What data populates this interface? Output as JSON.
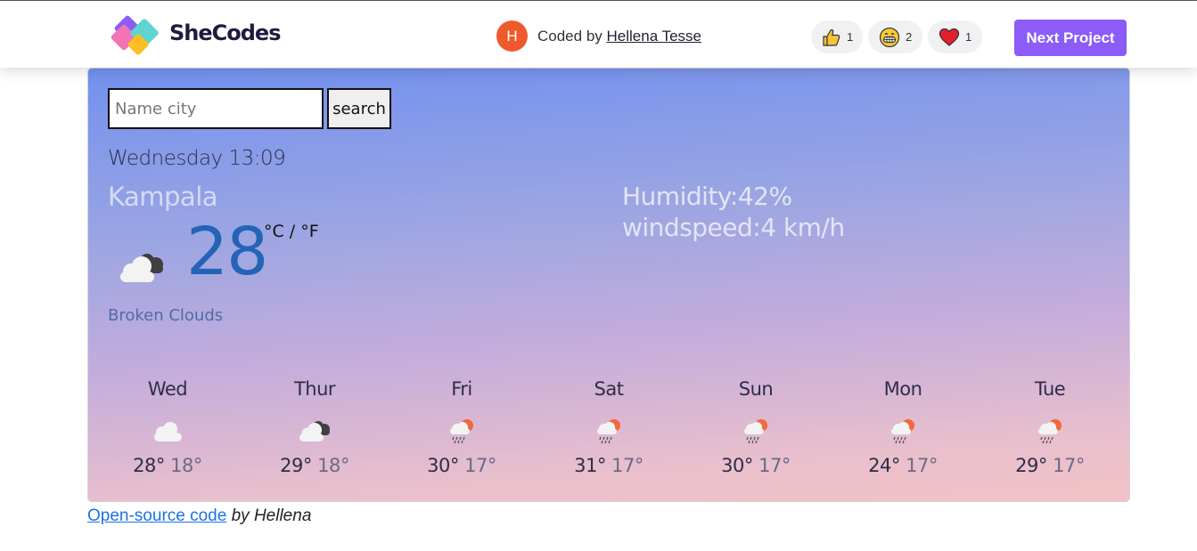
{
  "header": {
    "brand": "SheCodes",
    "avatar_initial": "H",
    "coded_by_prefix": "Coded by",
    "author": "Hellena Tesse",
    "reactions": [
      {
        "icon": "thumbs-up-icon",
        "count": "1"
      },
      {
        "icon": "grinning-face-icon",
        "count": "2"
      },
      {
        "icon": "heart-icon",
        "count": "1"
      }
    ],
    "next_button": "Next Project"
  },
  "search": {
    "placeholder": "Name city",
    "button_label": "search"
  },
  "current": {
    "datetime": "Wednesday 13:09",
    "city": "Kampala",
    "temperature": "28",
    "units": "°C / °F",
    "description": "Broken Clouds",
    "icon": "broken-clouds-icon",
    "humidity": "Humidity:42%",
    "wind": "windspeed:4 km/h"
  },
  "forecast": [
    {
      "day": "Wed",
      "max": "28°",
      "min": "18°",
      "icon": "cloud-icon"
    },
    {
      "day": "Thur",
      "max": "29°",
      "min": "18°",
      "icon": "broken-clouds-icon"
    },
    {
      "day": "Fri",
      "max": "30°",
      "min": "17°",
      "icon": "sun-rain-cloud-icon"
    },
    {
      "day": "Sat",
      "max": "31°",
      "min": "17°",
      "icon": "sun-rain-cloud-icon"
    },
    {
      "day": "Sun",
      "max": "30°",
      "min": "17°",
      "icon": "sun-rain-cloud-icon"
    },
    {
      "day": "Mon",
      "max": "24°",
      "min": "17°",
      "icon": "sun-rain-cloud-icon"
    },
    {
      "day": "Tue",
      "max": "29°",
      "min": "17°",
      "icon": "sun-rain-cloud-icon"
    }
  ],
  "footer": {
    "link_text": "Open-source code",
    "by_text": " by Hellena"
  },
  "colors": {
    "accent": "#8b5cf6",
    "temperature": "#2364b7",
    "avatar": "#ef5a2d",
    "link": "#1a73e8"
  }
}
